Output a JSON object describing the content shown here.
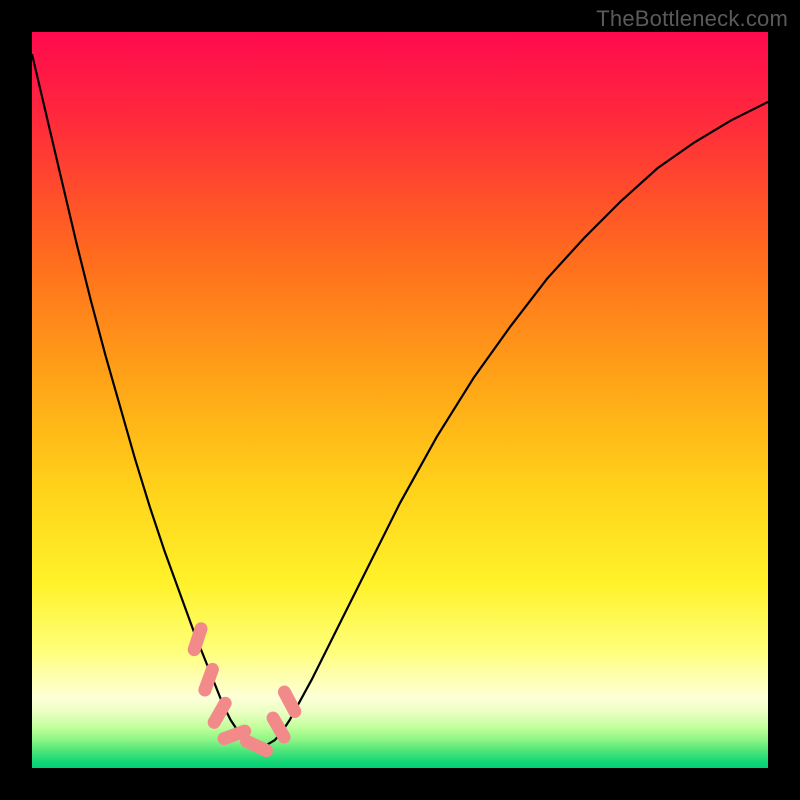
{
  "watermark": "TheBottleneck.com",
  "chart_data": {
    "type": "line",
    "title": "",
    "xlabel": "",
    "ylabel": "",
    "xlim": [
      0,
      100
    ],
    "ylim": [
      0,
      100
    ],
    "x": [
      0,
      2,
      4,
      6,
      8,
      10,
      12,
      14,
      16,
      18,
      20,
      22,
      23,
      24,
      25,
      26,
      27,
      28,
      29,
      30,
      31,
      32,
      33,
      34,
      35,
      38,
      42,
      46,
      50,
      55,
      60,
      65,
      70,
      75,
      80,
      85,
      90,
      95,
      100
    ],
    "y": [
      97,
      88.5,
      80,
      71.5,
      63.5,
      56,
      49,
      42,
      35.5,
      29.5,
      24,
      18.5,
      16,
      13.5,
      11,
      8.5,
      6.5,
      5,
      4,
      3.3,
      3,
      3.2,
      3.8,
      5,
      6.5,
      12,
      20,
      28,
      36,
      45,
      53,
      60,
      66.5,
      72,
      77,
      81.5,
      85,
      88,
      90.5
    ],
    "min_marker_indices": [
      24,
      26,
      28,
      30,
      32,
      34,
      35
    ],
    "gradient_stops": [
      {
        "offset": 0.0,
        "color": "#ff0a4e"
      },
      {
        "offset": 0.12,
        "color": "#ff2a3c"
      },
      {
        "offset": 0.3,
        "color": "#ff6a1e"
      },
      {
        "offset": 0.48,
        "color": "#ffa617"
      },
      {
        "offset": 0.62,
        "color": "#ffd21a"
      },
      {
        "offset": 0.75,
        "color": "#fff22a"
      },
      {
        "offset": 0.84,
        "color": "#ffff7a"
      },
      {
        "offset": 0.905,
        "color": "#fdffd8"
      },
      {
        "offset": 0.925,
        "color": "#e9ffc0"
      },
      {
        "offset": 0.945,
        "color": "#c0ff9a"
      },
      {
        "offset": 0.962,
        "color": "#8cf585"
      },
      {
        "offset": 0.975,
        "color": "#55e77a"
      },
      {
        "offset": 0.99,
        "color": "#18d877"
      },
      {
        "offset": 1.0,
        "color": "#00d074"
      }
    ],
    "marker_color": "#f38a8a",
    "curve_color": "#000000"
  }
}
